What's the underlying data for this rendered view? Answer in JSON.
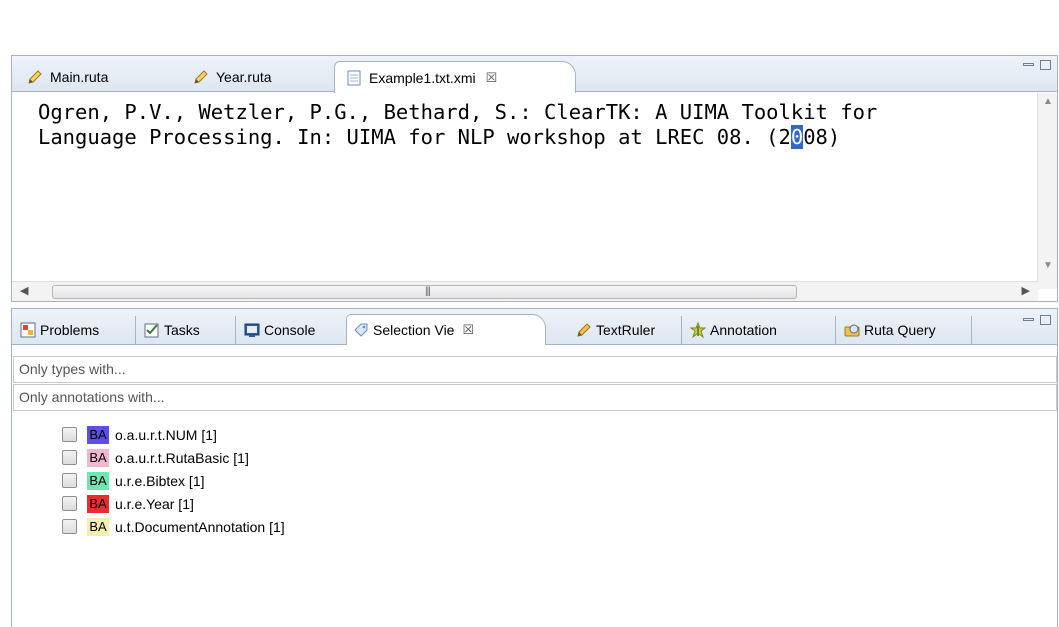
{
  "editor": {
    "tabs": [
      {
        "label": "Main.ruta",
        "icon": "pencil-icon"
      },
      {
        "label": "Year.ruta",
        "icon": "pencil-icon"
      },
      {
        "label": "Example1.txt.xmi",
        "icon": "document-icon",
        "close": "☒"
      }
    ],
    "line1": "Ogren, P.V., Wetzler, P.G., Bethard, S.: ClearTK: A UIMA Toolkit for",
    "line2_before": "Language Processing. In: UIMA for NLP workshop at LREC 08. (2",
    "line2_selected": "0",
    "line2_after": "08)"
  },
  "views": {
    "tabs": [
      {
        "label": "Problems",
        "icon": "problems-icon"
      },
      {
        "label": "Tasks",
        "icon": "tasks-icon"
      },
      {
        "label": "Console",
        "icon": "console-icon"
      },
      {
        "label": "Selection Vie",
        "icon": "selection-icon",
        "close": "☒"
      },
      {
        "label": "TextRuler",
        "icon": "pencil-icon"
      },
      {
        "label": "Annotation",
        "icon": "annotation-icon"
      },
      {
        "label": "Ruta Query",
        "icon": "query-icon"
      }
    ],
    "filter_types": "Only types with...",
    "filter_annotations": "Only annotations with...",
    "annotations": [
      {
        "badge": "BA",
        "label": "o.a.u.r.t.NUM [1]",
        "color": "#5e4ee8"
      },
      {
        "badge": "BA",
        "label": "o.a.u.r.t.RutaBasic [1]",
        "color": "#f0b6d4"
      },
      {
        "badge": "BA",
        "label": "u.r.e.Bibtex [1]",
        "color": "#6ee8b0"
      },
      {
        "badge": "BA",
        "label": "u.r.e.Year [1]",
        "color": "#e82e2e"
      },
      {
        "badge": "BA",
        "label": "u.t.DocumentAnnotation [1]",
        "color": "#f3eeb0"
      }
    ]
  }
}
